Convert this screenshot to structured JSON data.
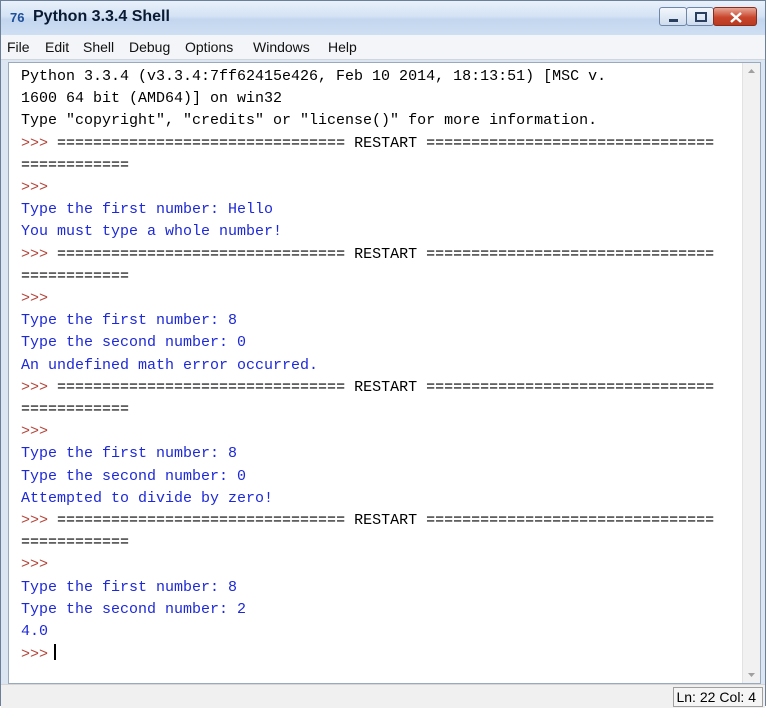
{
  "window": {
    "title": "Python 3.3.4 Shell",
    "icon_text": "76"
  },
  "menubar": {
    "items": [
      "File",
      "Edit",
      "Shell",
      "Debug",
      "Options",
      "Windows",
      "Help"
    ]
  },
  "shell": {
    "lines": [
      {
        "text": "Python 3.3.4 (v3.3.4:7ff62415e426, Feb 10 2014, 18:13:51) [MSC v.",
        "style": "out"
      },
      {
        "text": "1600 64 bit (AMD64)] on win32",
        "style": "out"
      },
      {
        "text": "Type \"copyright\", \"credits\" or \"license()\" for more information.",
        "style": "out"
      },
      {
        "text": ">>> ================================ RESTART ================================",
        "style": "out"
      },
      {
        "text": "============",
        "style": "out"
      },
      {
        "text": ">>>",
        "style": "prompt"
      },
      {
        "text": "Type the first number: Hello",
        "style": "blue"
      },
      {
        "text": "You must type a whole number!",
        "style": "blue"
      },
      {
        "text": ">>> ================================ RESTART ================================",
        "style": "out"
      },
      {
        "text": "============",
        "style": "out"
      },
      {
        "text": ">>>",
        "style": "prompt"
      },
      {
        "text": "Type the first number: 8",
        "style": "blue"
      },
      {
        "text": "Type the second number: 0",
        "style": "blue"
      },
      {
        "text": "An undefined math error occurred.",
        "style": "blue"
      },
      {
        "text": ">>> ================================ RESTART ================================",
        "style": "out"
      },
      {
        "text": "============",
        "style": "out"
      },
      {
        "text": ">>>",
        "style": "prompt"
      },
      {
        "text": "Type the first number: 8",
        "style": "blue"
      },
      {
        "text": "Type the second number: 0",
        "style": "blue"
      },
      {
        "text": "Attempted to divide by zero!",
        "style": "blue"
      },
      {
        "text": ">>> ================================ RESTART ================================",
        "style": "out"
      },
      {
        "text": "============",
        "style": "out"
      },
      {
        "text": ">>>",
        "style": "prompt"
      },
      {
        "text": "Type the first number: 8",
        "style": "blue"
      },
      {
        "text": "Type the second number: 2",
        "style": "blue"
      },
      {
        "text": "4.0",
        "style": "blue"
      },
      {
        "text": ">>>",
        "style": "prompt",
        "cursor": true
      }
    ]
  },
  "statusbar": {
    "line": "Ln: 22",
    "col": "Col: 4"
  },
  "colors": {
    "output": "#000000",
    "user_output": "#1d29d8",
    "prompt": "#b4453a"
  }
}
